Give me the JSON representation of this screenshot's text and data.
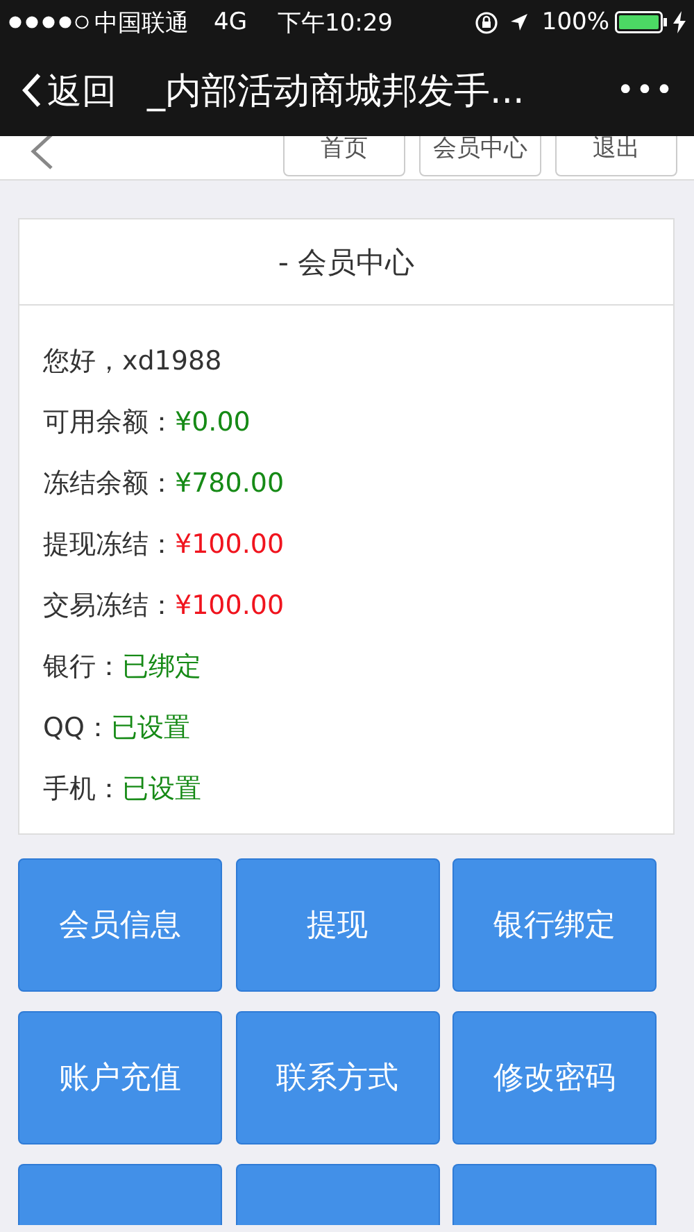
{
  "status_bar": {
    "carrier": "中国联通",
    "network": "4G",
    "time": "下午10:29",
    "battery": "100%"
  },
  "nav_bar": {
    "back": "返回",
    "title": "_内部活动商城邦发手...",
    "more": "•••"
  },
  "top_links": [
    "首页",
    "会员中心",
    "退出"
  ],
  "card": {
    "title": "- 会员中心",
    "rows": [
      {
        "label": "您好，xd1988"
      },
      {
        "label": "可用余额：",
        "value": "¥0.00",
        "color": "#168a16"
      },
      {
        "label": "冻结余额：",
        "value": "¥780.00",
        "color": "#168a16"
      },
      {
        "label": "提现冻结：",
        "value": "¥100.00",
        "color": "#f0141e"
      },
      {
        "label": "交易冻结：",
        "value": "¥100.00",
        "color": "#f0141e"
      },
      {
        "label": "银行：",
        "value": "已绑定",
        "color": "#168a16"
      },
      {
        "label": "QQ：",
        "value": "已设置",
        "color": "#168a16"
      },
      {
        "label": "手机：",
        "value": "已设置",
        "color": "#168a16"
      }
    ]
  },
  "buttons": [
    {
      "kind": "full",
      "label": "会员信息"
    },
    {
      "kind": "full",
      "label": "提现"
    },
    {
      "kind": "full",
      "label": "银行绑定"
    },
    {
      "kind": "full",
      "label": "账户充值"
    },
    {
      "kind": "full",
      "label": "联系方式"
    },
    {
      "kind": "full",
      "label": "修改密码"
    },
    {
      "kind": "cut"
    },
    {
      "kind": "cut"
    },
    {
      "kind": "cut"
    }
  ]
}
